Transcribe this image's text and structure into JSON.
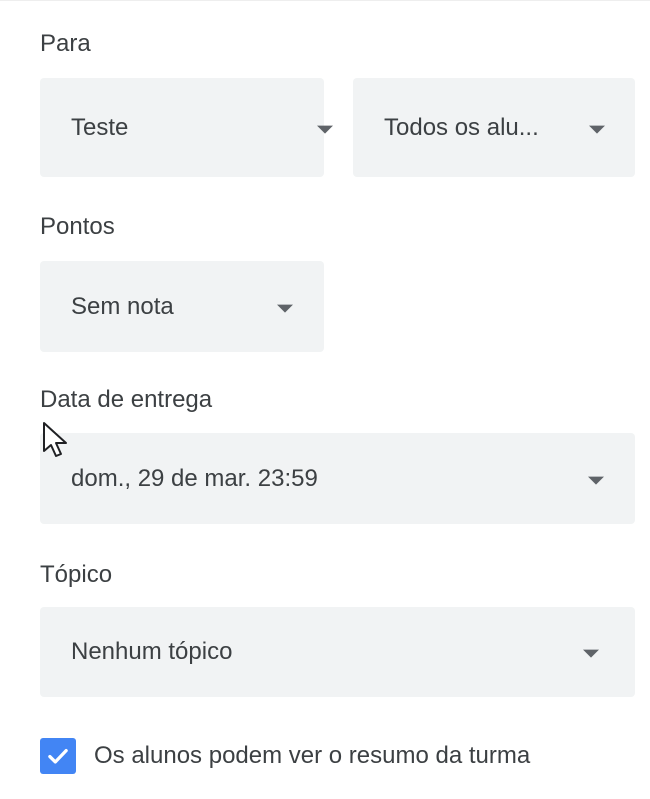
{
  "para": {
    "label": "Para",
    "class_value": "Teste",
    "students_value": "Todos os alu..."
  },
  "pontos": {
    "label": "Pontos",
    "value": "Sem nota"
  },
  "data_entrega": {
    "label": "Data de entrega",
    "value": "dom., 29 de mar. 23:59"
  },
  "topico": {
    "label": "Tópico",
    "value": "Nenhum tópico"
  },
  "summary_checkbox": {
    "label": "Os alunos podem ver o resumo da turma",
    "checked": true
  },
  "icons": {
    "dropdown": "dropdown-arrow-icon",
    "check": "check-icon",
    "cursor": "mouse-pointer-icon"
  },
  "colors": {
    "field_background": "#f1f3f4",
    "checkbox": "#4285f4",
    "text": "#3c4043",
    "arrow": "#5f6368"
  }
}
